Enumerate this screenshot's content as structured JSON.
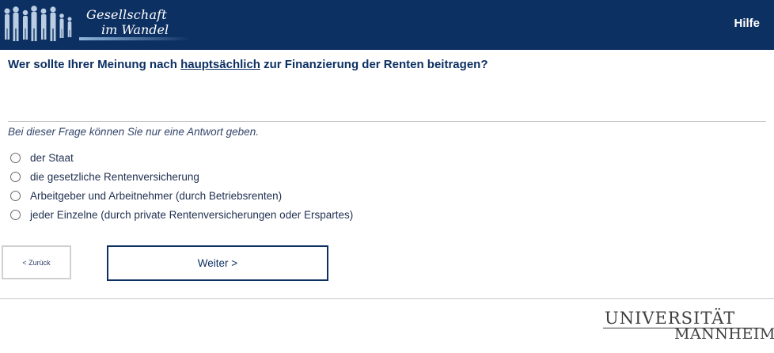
{
  "header": {
    "logo": {
      "line1": "Gesellschaft",
      "line2": "im Wandel",
      "icon": "people-silhouettes-icon"
    },
    "help_label": "Hilfe",
    "background_color": "#0d3062"
  },
  "question": {
    "before": "Wer sollte Ihrer Meinung nach ",
    "emphasis": "hauptsächlich",
    "after": " zur Finanzierung der Renten beitragen?"
  },
  "instruction": "Bei dieser Frage können Sie nur eine Antwort geben.",
  "options": [
    {
      "label": "der Staat",
      "selected": false
    },
    {
      "label": "die gesetzliche Rentenversicherung",
      "selected": false
    },
    {
      "label": "Arbeitgeber und Arbeitnehmer (durch Betriebsrenten)",
      "selected": false
    },
    {
      "label": "jeder Einzelne (durch private Rentenversicherungen oder Erspartes)",
      "selected": false
    }
  ],
  "navigation": {
    "back_label": "< Zurück",
    "next_label": "Weiter >"
  },
  "footer": {
    "university_top": "UNIVERSITÄT",
    "university_bottom": "MANNHEIM"
  }
}
